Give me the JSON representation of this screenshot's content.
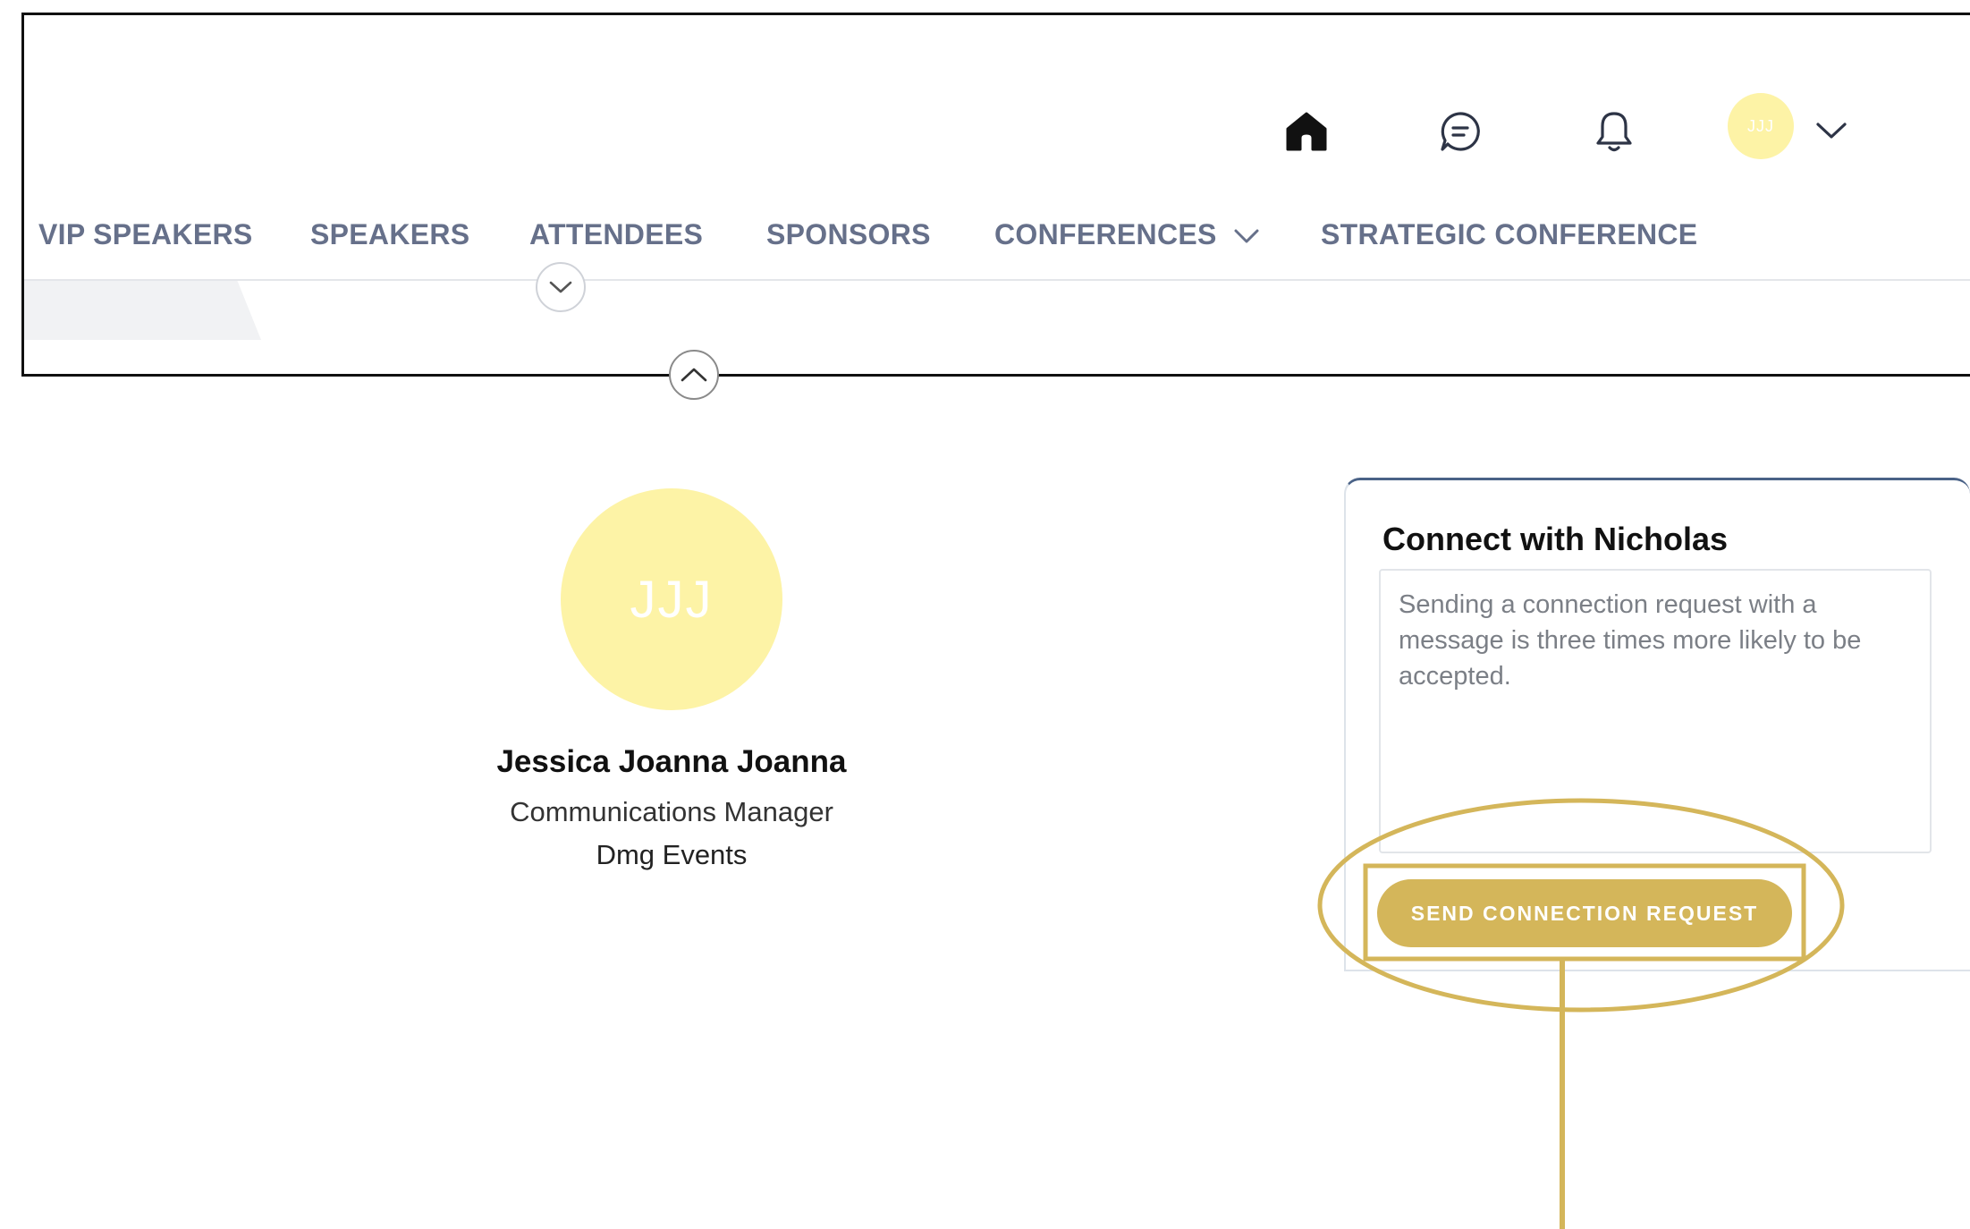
{
  "header": {
    "nav": {
      "items": [
        {
          "label": "VIP SPEAKERS"
        },
        {
          "label": "SPEAKERS"
        },
        {
          "label": "ATTENDEES"
        },
        {
          "label": "SPONSORS"
        },
        {
          "label": "CONFERENCES"
        },
        {
          "label": "STRATEGIC CONFERENCE"
        }
      ]
    },
    "icons": {
      "home": "home-icon",
      "chat": "chat-icon",
      "notifications": "bell-icon",
      "avatar_menu": "chevron-down-icon"
    },
    "user_avatar_initials": "JJJ"
  },
  "profile": {
    "initials": "JJJ",
    "name": "Jessica Joanna Joanna",
    "role": "Communications Manager",
    "company": "Dmg Events"
  },
  "connect": {
    "title": "Connect with Nicholas",
    "message_placeholder": "Sending a connection request with a message is three times more likely to be accepted.",
    "message_value": "",
    "send_label": "SEND CONNECTION REQUEST"
  },
  "colors": {
    "accent_gold": "#d4b65a",
    "avatar_yellow": "#fdf3a6",
    "nav_text": "#66708a",
    "card_top_border": "#4a6287"
  }
}
